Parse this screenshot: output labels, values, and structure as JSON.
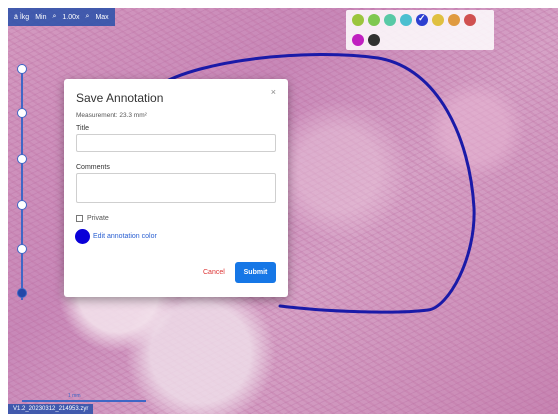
{
  "toolbar": {
    "slide_label": "ä Ìkg",
    "min_label": "Min",
    "zoom_label": "1.00x",
    "max_label": "Max"
  },
  "palette": {
    "colors": [
      "#9bc53d",
      "#7ec850",
      "#58c9a6",
      "#4bbfd0",
      "#2d3fd0",
      "#e0c040",
      "#e09a40",
      "#d05050",
      "#c020c0",
      "#303030"
    ],
    "selected_color": "#2d3fd0"
  },
  "zoom_levels": 6,
  "active_zoom_index": 5,
  "annotation_color": "#1a1aa8",
  "footer": {
    "slide_id": "V1.2_20230312_214953.zyr",
    "scale_label": "1 mm"
  },
  "modal": {
    "title": "Save Annotation",
    "close_symbol": "×",
    "measurement": "Measurement: 23.3 mm²",
    "title_label": "Title",
    "title_value": "",
    "comments_label": "Comments",
    "comments_value": "",
    "private_label": "Private",
    "private_checked": false,
    "edit_color_label": "Edit annotation color",
    "cancel_label": "Cancel",
    "submit_label": "Submit"
  }
}
